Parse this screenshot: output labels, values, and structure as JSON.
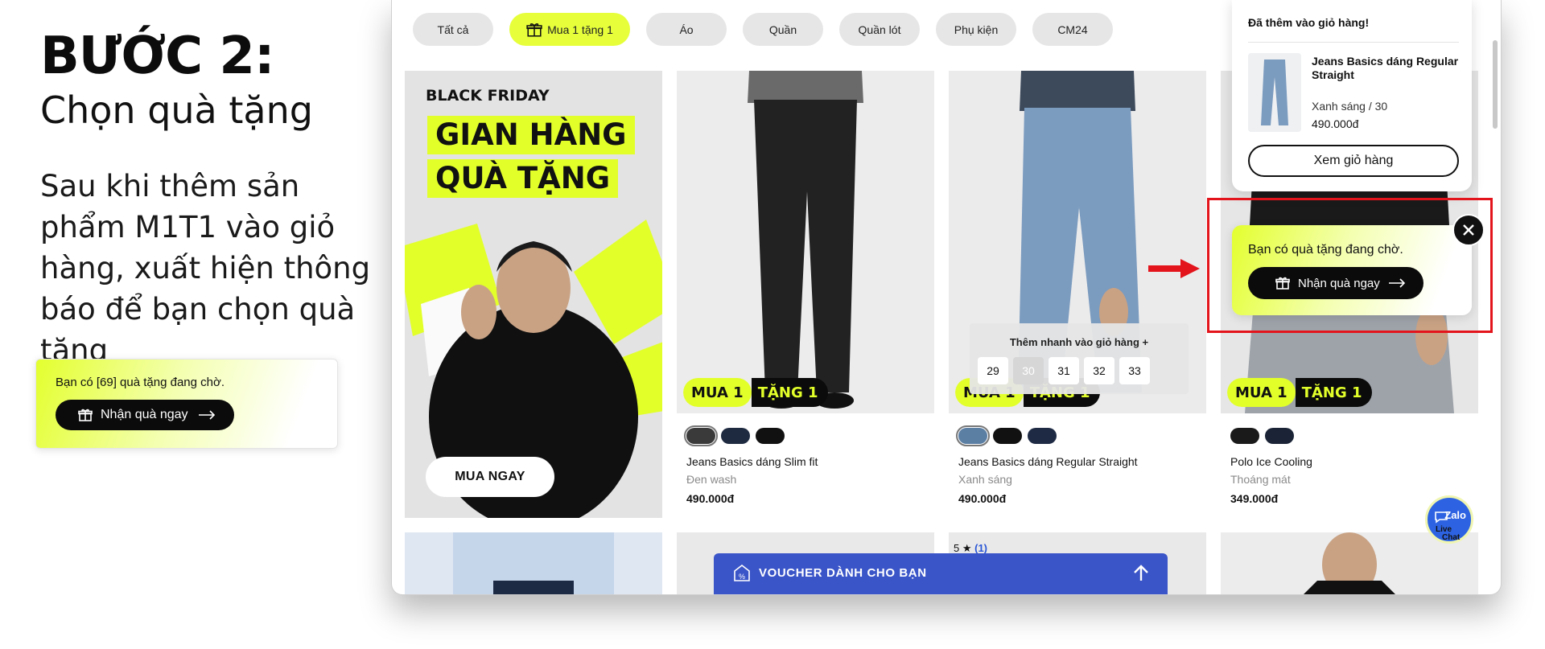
{
  "left": {
    "step_title": "BƯỚC 2:",
    "step_subtitle": "Chọn quà tặng",
    "description": "Sau khi thêm sản phẩm M1T1 vào giỏ hàng, xuất hiện thông báo để bạn chọn quà tặng",
    "gift_notice": "Bạn có [69] quà tặng đang chờ.",
    "gift_button": "Nhận quà ngay"
  },
  "filters": [
    "Tất cả",
    "Mua 1 tặng 1",
    "Áo",
    "Quần",
    "Quần lót",
    "Phụ kiện",
    "CM24"
  ],
  "active_filter": 1,
  "banner": {
    "black_friday": "BLACK FRIDAY",
    "line1": "GIAN HÀNG",
    "line2": "QUÀ TẶNG",
    "buy_button": "MUA NGAY"
  },
  "badge": {
    "part1": "MUA 1",
    "part2": "TẶNG 1"
  },
  "products": [
    {
      "name": "Jeans Basics dáng Slim fit",
      "color": "Đen wash",
      "price": "490.000đ",
      "swatches": [
        "#3a3a3a",
        "#1e2a40",
        "#111111"
      ]
    },
    {
      "name": "Jeans Basics dáng Regular Straight",
      "color": "Xanh sáng",
      "price": "490.000đ",
      "swatches": [
        "#5b7ea3",
        "#111111",
        "#1e2a44"
      ]
    },
    {
      "name": "Polo Ice Cooling",
      "color": "Thoáng mát",
      "price": "349.000đ",
      "swatches": [
        "#1a1a1a",
        "#1b2436"
      ]
    }
  ],
  "quick_add": {
    "title": "Thêm nhanh vào giỏ hàng +",
    "sizes": [
      "29",
      "30",
      "31",
      "32",
      "33"
    ]
  },
  "cart_popup": {
    "heading": "Đã thêm vào giỏ hàng!",
    "product_name": "Jeans Basics dáng Regular Straight",
    "variant": "Xanh sáng / 30",
    "price": "490.000đ",
    "view_cart": "Xem giỏ hàng"
  },
  "gift_popup": {
    "text": "Bạn có quà tặng đang chờ.",
    "button": "Nhận quà ngay"
  },
  "voucher": {
    "label": "VOUCHER DÀNH CHO BẠN"
  },
  "rating": {
    "stars": "5 ★",
    "count": "(1)"
  },
  "zalo": {
    "brand": "Zalo",
    "line1": "Live",
    "line2": "Chat"
  },
  "colors": {
    "accent_lime": "#e2ff2a",
    "voucher_blue": "#3a55c8",
    "highlight_red": "#e3141b"
  }
}
